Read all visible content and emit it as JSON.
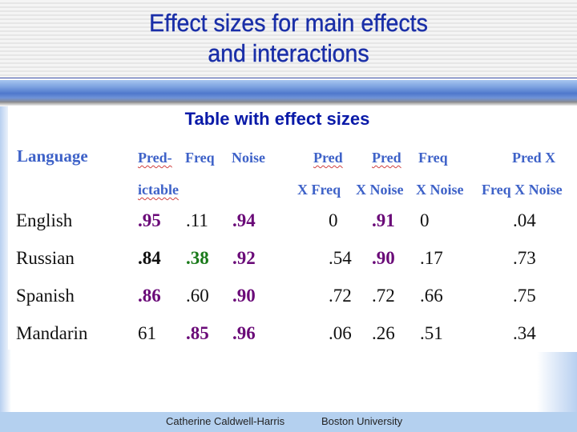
{
  "slide": {
    "title_line1": "Effect sizes for main effects",
    "title_line2": "and interactions"
  },
  "table": {
    "title": "Table with effect sizes",
    "header": {
      "language": "Language",
      "col1_a": "Pred-",
      "col1_b": "ictable",
      "col2": "Freq",
      "col3": "Noise",
      "col4_a": "Pred",
      "col4_b": "X Freq",
      "col5_a": "Pred",
      "col5_b": "X Noise",
      "col6_a": "Freq",
      "col6_b": "X Noise",
      "col7_a": "Pred X",
      "col7_b": "Freq X Noise"
    },
    "rows": [
      {
        "language": "English",
        "values": [
          ".95",
          ".11",
          ".94",
          "0",
          ".91",
          "0",
          ".04"
        ]
      },
      {
        "language": "Russian",
        "values": [
          ".84",
          ".38",
          ".92",
          ".54",
          ".90",
          ".17",
          ".73"
        ]
      },
      {
        "language": "Spanish",
        "values": [
          ".86",
          ".60",
          ".90",
          ".72",
          ".72",
          ".66",
          ".75"
        ]
      },
      {
        "language": "Mandarin",
        "values": [
          "61",
          ".85",
          ".96",
          ".06",
          ".26",
          ".51",
          ".34"
        ]
      }
    ],
    "colors": {
      "purple": "#6a0a78",
      "green": "#1a7a1a",
      "black": "#111111"
    },
    "highlight": [
      [
        "purple",
        "black",
        "purple",
        "black",
        "purple",
        "black",
        "black"
      ],
      [
        "black-bold",
        "green",
        "purple",
        "black",
        "purple",
        "black",
        "black"
      ],
      [
        "purple",
        "black",
        "purple",
        "black",
        "black",
        "black",
        "black"
      ],
      [
        "black",
        "purple",
        "purple",
        "black",
        "black",
        "black",
        "black"
      ]
    ]
  },
  "footer": {
    "author": "Catherine Caldwell-Harris",
    "institution": "Boston University"
  }
}
